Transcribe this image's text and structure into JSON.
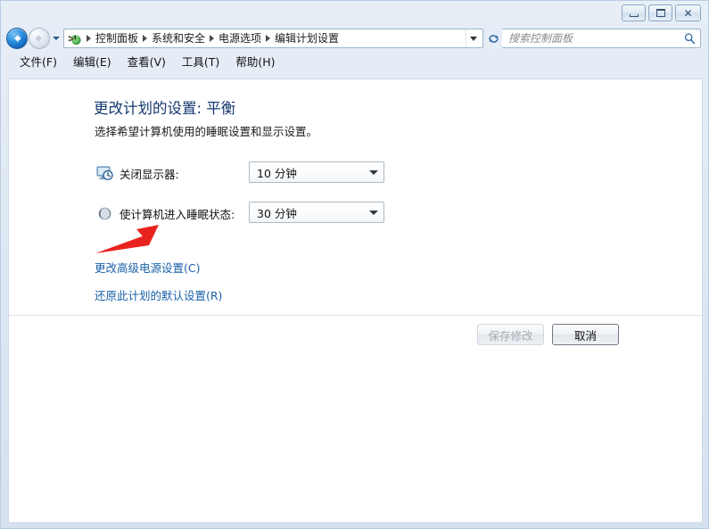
{
  "window": {
    "controls": [
      {
        "name": "minimize",
        "glyph": "minimize-icon"
      },
      {
        "name": "maximize",
        "glyph": "maximize-icon"
      },
      {
        "name": "close",
        "glyph": "close-icon",
        "label": "✕"
      }
    ]
  },
  "navbar": {
    "back_tooltip": "back-icon",
    "forward_tooltip": "forward-icon",
    "address_icon": "power-options-icon",
    "breadcrumbs": [
      "控制面板",
      "系统和安全",
      "电源选项",
      "编辑计划设置"
    ],
    "refresh_icon": "refresh-icon",
    "search": {
      "placeholder": "搜索控制面板",
      "value": "",
      "icon": "search-icon"
    }
  },
  "menubar": {
    "items": [
      "文件(F)",
      "编辑(E)",
      "查看(V)",
      "工具(T)",
      "帮助(H)"
    ]
  },
  "page": {
    "title": "更改计划的设置: 平衡",
    "subtitle": "选择希望计算机使用的睡眠设置和显示设置。",
    "settings": [
      {
        "icon": "monitor-clock-icon",
        "label": "关闭显示器:",
        "value": "10 分钟"
      },
      {
        "icon": "sleep-moon-icon",
        "label": "使计算机进入睡眠状态:",
        "value": "30 分钟"
      }
    ],
    "links": [
      "更改高级电源设置(C)",
      "还原此计划的默认设置(R)"
    ],
    "buttons": {
      "save": "保存修改",
      "cancel": "取消"
    }
  },
  "annotation": {
    "type": "red-arrow",
    "color": "#e8231f",
    "points_to": "sleep-combo"
  }
}
